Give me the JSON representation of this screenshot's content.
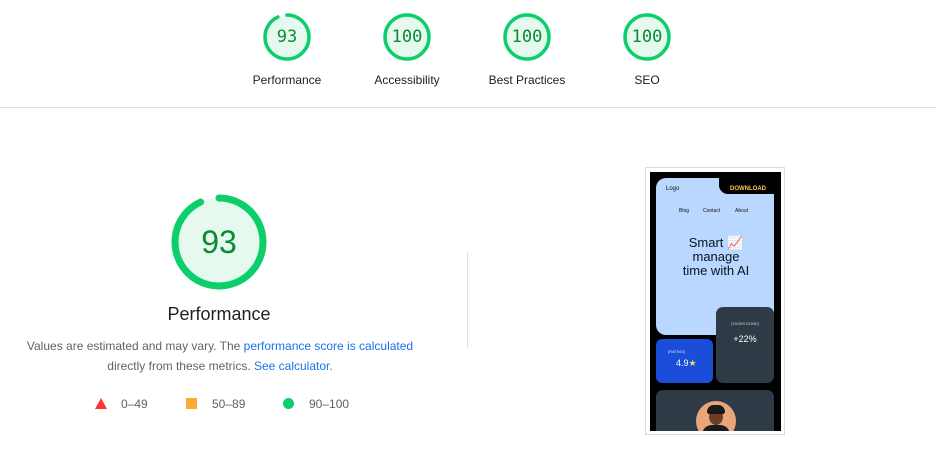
{
  "categories": [
    {
      "label": "Performance",
      "score": "93",
      "fraction": 0.93
    },
    {
      "label": "Accessibility",
      "score": "100",
      "fraction": 1.0
    },
    {
      "label": "Best Practices",
      "score": "100",
      "fraction": 1.0
    },
    {
      "label": "SEO",
      "score": "100",
      "fraction": 1.0
    }
  ],
  "performance": {
    "score": "93",
    "fraction": 0.93,
    "title": "Performance",
    "desc_part1": "Values are estimated and may vary. The ",
    "desc_link1": "performance score is calculated",
    "desc_part2": " directly from these metrics. ",
    "desc_link2": "See calculator",
    "desc_end": "."
  },
  "legend": [
    {
      "range": "0–49",
      "shape": "triangle",
      "color": "#ff3333"
    },
    {
      "range": "50–89",
      "shape": "square",
      "color": "#ffaa33"
    },
    {
      "range": "90–100",
      "shape": "circle",
      "color": "#0cce6b"
    }
  ],
  "screenshot": {
    "logo": "Logo",
    "download": "DOWNLOAD",
    "nav": [
      "Blog",
      "Contact",
      "About"
    ],
    "hero_line1": "Smart 📈",
    "hero_line2": "manage",
    "hero_line3": "time with AI",
    "tasks_label": "[TASKS DONE]",
    "tasks_value": "+22%",
    "rating_label": "[RATING]",
    "rating_value": "4.9",
    "rating_star": "★"
  },
  "colors": {
    "pass_ring": "#0cce6b",
    "pass_fill": "#e6f9ee",
    "pass_text": "#0a8a33",
    "link": "#1a73e8"
  }
}
